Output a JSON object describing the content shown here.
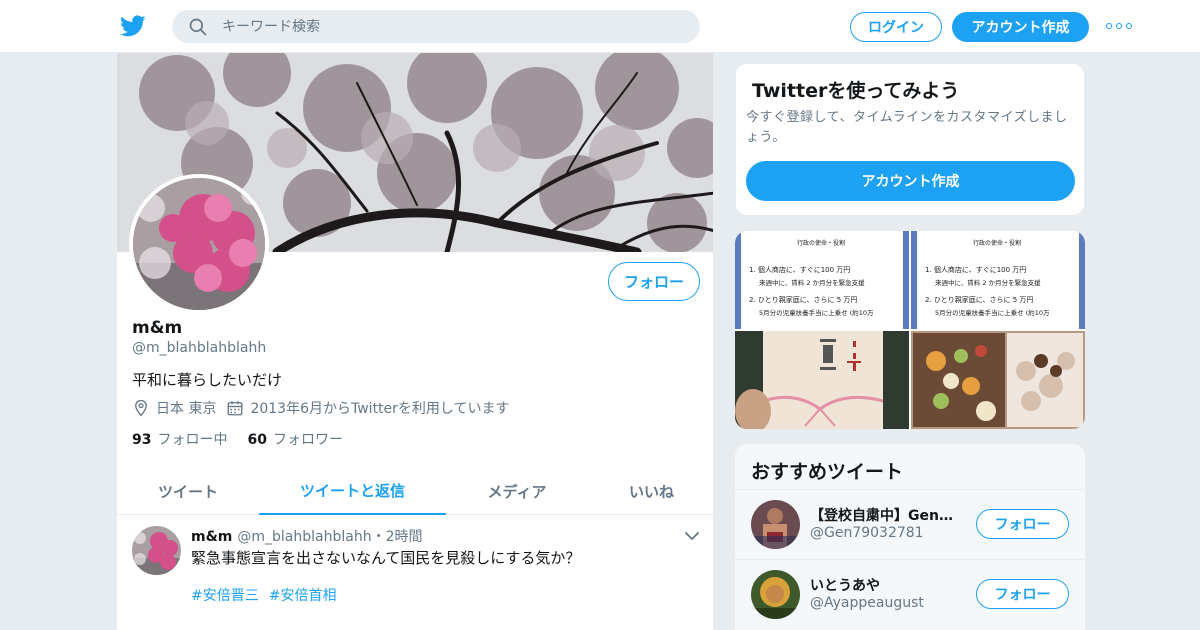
{
  "topbar": {
    "logo_icon": "twitter-bird-icon",
    "search": {
      "placeholder": "キーワード検索",
      "value": ""
    },
    "login_label": "ログイン",
    "signup_label": "アカウント作成",
    "more_icon": "more-horizontal-icon"
  },
  "profile": {
    "name": "m&m",
    "handle": "@m_blahblahblahh",
    "bio": "平和に暮らしたいだけ",
    "location": "日本 東京",
    "joined": "2013年6月からTwitterを利用しています",
    "following_count": "93",
    "following_label": "フォロー中",
    "followers_count": "60",
    "followers_label": "フォロワー",
    "follow_label": "フォロー"
  },
  "tabs": [
    {
      "label": "ツイート",
      "active": false
    },
    {
      "label": "ツイートと返信",
      "active": true
    },
    {
      "label": "メディア",
      "active": false
    },
    {
      "label": "いいね",
      "active": false
    }
  ],
  "tweet": {
    "name": "m&m",
    "handle": "@m_blahblahblahh",
    "time": "・2時間",
    "text": "緊急事態宣言を出さないなんて国民を見殺しにする気か？",
    "hashtags": [
      "#安倍晋三",
      "#安倍首相"
    ]
  },
  "signup_card": {
    "title": "Twitterを使ってみよう",
    "description": "今すぐ登録して、タイムラインをカスタマイズしましょう。",
    "button_label": "アカウント作成"
  },
  "media_doc": {
    "heading": "行政の使命・役割",
    "line1": "1. 個人商店に、すぐに100 万円",
    "line2": "来週中に、賃料 2 か月分を緊急支援",
    "line3": "2. ひとり親家庭に、さらに 5 万円",
    "line4": "5月分の児童扶養手当に上乗せ (約10万"
  },
  "recommended": {
    "title": "おすすめツイート",
    "accounts": [
      {
        "name": "【登校自粛中】Gen…",
        "handle": "@Gen79032781",
        "follow_label": "フォロー"
      },
      {
        "name": "いとうあや",
        "handle": "@Ayappeaugust",
        "follow_label": "フォロー"
      }
    ]
  },
  "colors": {
    "accent": "#1da1f2",
    "text": "#14171a",
    "muted": "#657786",
    "background": "#e6ecf0"
  }
}
